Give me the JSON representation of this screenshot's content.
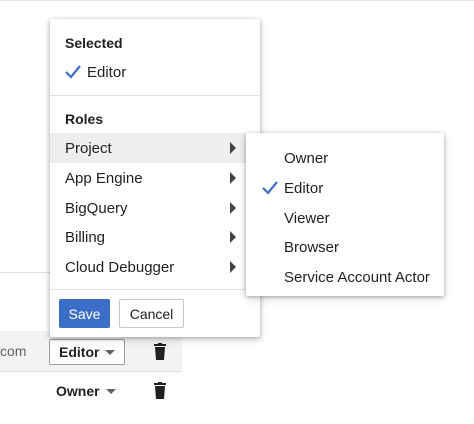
{
  "background": {
    "email_fragment": "com",
    "rows": [
      {
        "role": "Editor"
      },
      {
        "role": "Owner"
      }
    ]
  },
  "menu": {
    "selected_heading": "Selected",
    "selected_item": "Editor",
    "roles_heading": "Roles",
    "roles": [
      {
        "label": "Project",
        "highlighted": true
      },
      {
        "label": "App Engine"
      },
      {
        "label": "BigQuery"
      },
      {
        "label": "Billing"
      },
      {
        "label": "Cloud Debugger"
      }
    ],
    "save_label": "Save",
    "cancel_label": "Cancel"
  },
  "submenu": {
    "items": [
      {
        "label": "Owner"
      },
      {
        "label": "Editor",
        "checked": true
      },
      {
        "label": "Viewer"
      },
      {
        "label": "Browser"
      },
      {
        "label": "Service Account Actor"
      }
    ]
  },
  "colors": {
    "accent": "#3b6fc7",
    "check": "#3b6fc7",
    "highlight_row": "#eeeeee"
  }
}
